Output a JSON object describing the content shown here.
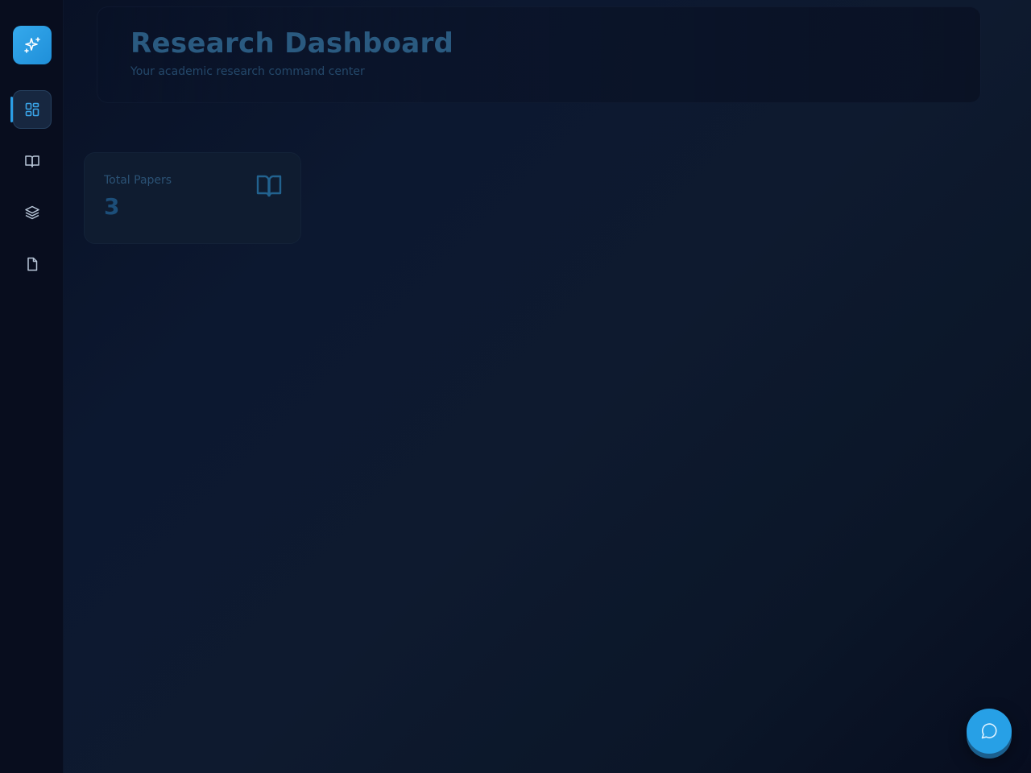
{
  "sidebar": {
    "logo_icon": "sparkles-icon",
    "items": [
      {
        "id": "dashboard",
        "icon": "dashboard-grid-icon",
        "active": true
      },
      {
        "id": "library",
        "icon": "open-book-icon",
        "active": false
      },
      {
        "id": "collections",
        "icon": "layers-icon",
        "active": false
      },
      {
        "id": "documents",
        "icon": "document-icon",
        "active": false
      }
    ]
  },
  "header": {
    "title": "Research Dashboard",
    "subtitle": "Your academic research command center"
  },
  "stats": [
    {
      "label": "Total Papers",
      "value": "3",
      "icon": "open-book-icon"
    }
  ],
  "fab": {
    "icon": "chat-bubble-icon"
  },
  "colors": {
    "accent": "#27a0e6",
    "background": "#0b1426",
    "sidebar": "#080d1e",
    "card": "#0f1c30"
  }
}
